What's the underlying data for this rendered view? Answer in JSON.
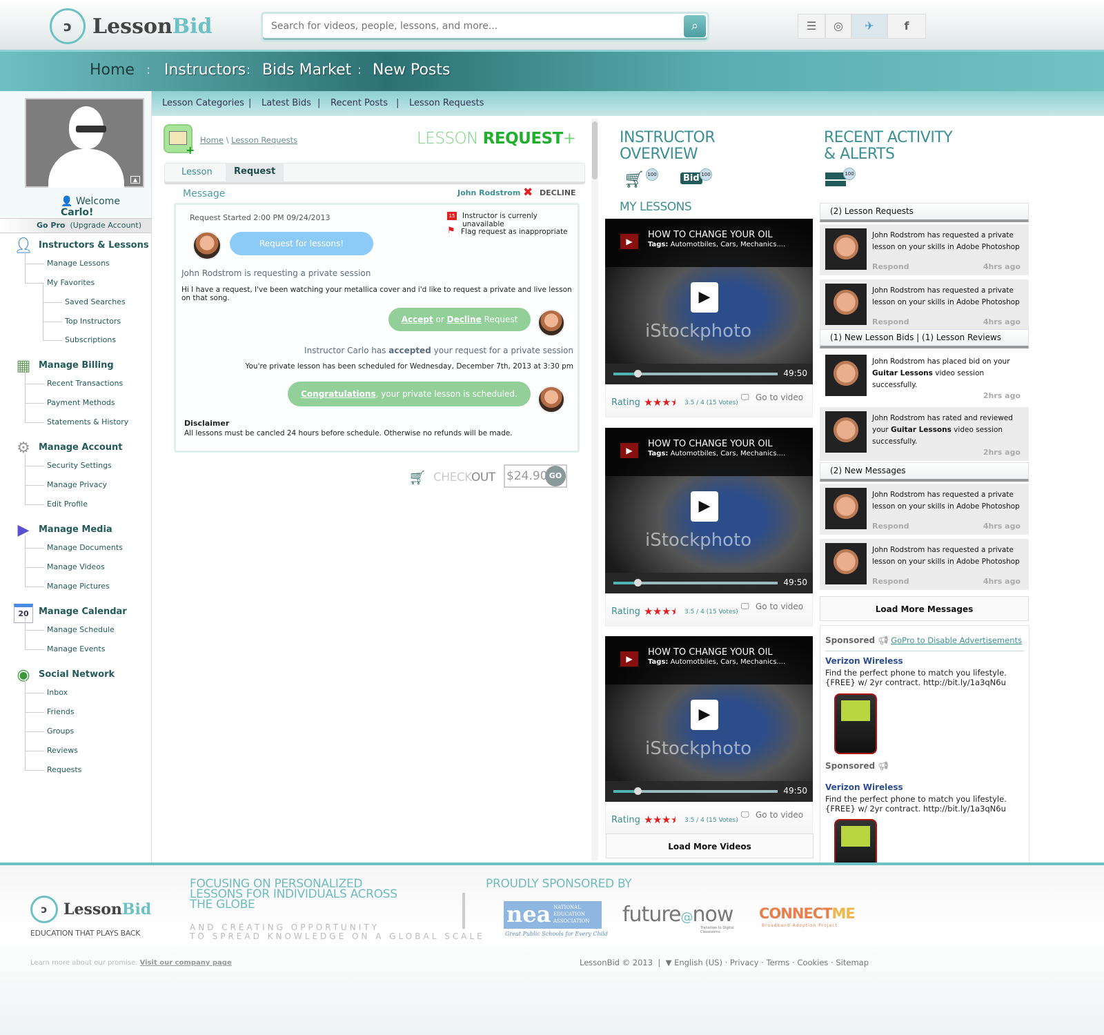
{
  "brand": {
    "name_a": "Lesson",
    "name_b": "Bid",
    "tagline": "EDUCATION THAT PLAYS BACK"
  },
  "search": {
    "placeholder": "Search for videos, people, lessons, and more...",
    "icon": "search-icon"
  },
  "social": [
    {
      "icon": "rss-icon",
      "glyph": "⦿"
    },
    {
      "icon": "dribbble-icon",
      "glyph": "◎"
    },
    {
      "icon": "twitter-icon",
      "glyph": "❧"
    },
    {
      "icon": "facebook-icon",
      "glyph": "f"
    }
  ],
  "nav": {
    "items": [
      "Home",
      "Instructors",
      "Bids Market",
      "New Posts"
    ],
    "active": "Home",
    "separator": ":"
  },
  "subnav": {
    "items": [
      "Lesson Categories",
      "Latest Bids",
      "Recent Posts",
      "Lesson Requests"
    ],
    "separator": "|"
  },
  "user": {
    "welcome": "Welcome",
    "name": "Carlo!",
    "go_pro": "Go Pro",
    "upgrade": "(Upgrade Account)"
  },
  "sidebar": [
    {
      "title": "Instructors & Lessons",
      "icon": "user-icon",
      "items": [
        {
          "label": "Manage Lessons",
          "level": 1
        },
        {
          "label": "My Favorites",
          "level": 1
        },
        {
          "label": "Saved Searches",
          "level": 2
        },
        {
          "label": "Top Instructors",
          "level": 2
        },
        {
          "label": "Subscriptions",
          "level": 2
        }
      ]
    },
    {
      "title": "Manage Billing",
      "icon": "calculator-icon",
      "items": [
        {
          "label": "Recent Transactions",
          "level": 1
        },
        {
          "label": "Payment Methods",
          "level": 1
        },
        {
          "label": "Statements & History",
          "level": 1
        }
      ]
    },
    {
      "title": "Manage Account",
      "icon": "gear-icon",
      "items": [
        {
          "label": "Security Settings",
          "level": 1
        },
        {
          "label": "Manage Privacy",
          "level": 1
        },
        {
          "label": "Edit Profile",
          "level": 1
        }
      ]
    },
    {
      "title": "Manage Media",
      "icon": "media-play-icon",
      "items": [
        {
          "label": "Manage Documents",
          "level": 1
        },
        {
          "label": "Manage Videos",
          "level": 1
        },
        {
          "label": "Manage Pictures",
          "level": 1
        }
      ]
    },
    {
      "title": "Manage Calendar",
      "icon": "calendar-icon",
      "calendar_day": "20",
      "items": [
        {
          "label": "Manage Schedule",
          "level": 1
        },
        {
          "label": "Manage Events",
          "level": 1
        }
      ]
    },
    {
      "title": "Social Network",
      "icon": "chat-icon",
      "items": [
        {
          "label": "Inbox",
          "level": 1
        },
        {
          "label": "Friends",
          "level": 1
        },
        {
          "label": "Groups",
          "level": 1
        },
        {
          "label": "Reviews",
          "level": 1
        },
        {
          "label": "Requests",
          "level": 1
        }
      ]
    }
  ],
  "request": {
    "breadcrumb": [
      "Home",
      "Lesson Requests"
    ],
    "title_light": "LESSON",
    "title_bold": "REQUEST",
    "title_plus": "+",
    "tabs": [
      "Lesson",
      "Request"
    ],
    "active_tab": "Request",
    "message_label": "Message",
    "sender": "John Rodstrom",
    "decline": "DECLINE",
    "started": "Request Started 2:00 PM 09/24/2013",
    "calendar_day": "15",
    "unavailable": "Instructor is currenly unavailable",
    "flag": "Flag request as inappropriate",
    "bubble1": "Request for lessons!",
    "requesting": "John Rodstrom is requesting a private session",
    "body": "Hi I have a request, I've been watching your metallica cover and i'd like to request a private and live lesson on that song.",
    "accept": "Accept",
    "or": "or",
    "decline_link": "Decline",
    "request_word": "Request",
    "accepted_pre": "Instructor Carlo has",
    "accepted_bold": "accepted",
    "accepted_post": "your request for a private session",
    "scheduled": "You're private lesson has been scheduled for Wednesday, December 7th, 2013 at 3:30 pm",
    "congrats": "Congratulations",
    "congrats_rest": ", your private lesson is scheduled.",
    "disclaimer_title": "Disclaimer",
    "disclaimer": "All lessons must be cancled 24 hours before schedule. Otherwise no refunds will be made.",
    "checkout_a": "CHECK",
    "checkout_b": "OUT",
    "price": "$24.90",
    "go": "GO"
  },
  "overview": {
    "title1": "INSTRUCTOR",
    "title2": "OVERVIEW",
    "badges": [
      {
        "icon": "cart-icon",
        "count": "100"
      },
      {
        "icon": "bid-icon",
        "label": "Bid",
        "count": "100"
      }
    ],
    "my_lessons": "MY LESSONS",
    "lessons": [
      {
        "title": "HOW TO CHANGE YOUR OIL",
        "tags_label": "Tags:",
        "tags": "Automotbiles, Cars, Mechanics....",
        "watermark": "iStockphoto",
        "duration": "49:50",
        "progress": 0.15,
        "rating_label": "Rating",
        "stars": 3.5,
        "rating": "3.5 / 4 (15 Votes)",
        "go": "Go to video"
      },
      {
        "title": "HOW TO CHANGE YOUR OIL",
        "tags_label": "Tags:",
        "tags": "Automotbiles, Cars, Mechanics....",
        "watermark": "iStockphoto",
        "duration": "49:50",
        "progress": 0.15,
        "rating_label": "Rating",
        "stars": 3.5,
        "rating": "3.5 / 4 (15 Votes)",
        "go": "Go to video"
      },
      {
        "title": "HOW TO CHANGE YOUR OIL",
        "tags_label": "Tags:",
        "tags": "Automotbiles, Cars, Mechanics....",
        "watermark": "iStockphoto",
        "duration": "49:50",
        "progress": 0.15,
        "rating_label": "Rating",
        "stars": 3.5,
        "rating": "3.5 / 4 (15 Votes)",
        "go": "Go to video"
      }
    ],
    "load_more": "Load More Videos"
  },
  "activity": {
    "title1": "RECENT ACTIVITY",
    "title2": "& ALERTS",
    "mail_count": "100",
    "requests_head": "(2) Lesson Requests",
    "requests": [
      {
        "text": "John Rodstrom has requested a private lesson on your skills in Adobe Photoshop",
        "action": "Respond",
        "time": "4hrs ago"
      },
      {
        "text": "John Rodstrom has requested a private lesson on your skills in Adobe Photoshop",
        "action": "Respond",
        "time": "4hrs ago"
      }
    ],
    "bids_head": "(1) New Lesson Bids  |  (1) Lesson Reviews",
    "bids": [
      {
        "text": "John Rodstrom has placed bid on your Guitar Lessons video session successfully.",
        "action": "",
        "time": "2hrs ago"
      },
      {
        "text": "John Rodstrom has rated and reviewed your Guitar Lessons video session successfully.",
        "action": "",
        "time": "2hrs ago"
      }
    ],
    "messages_head": "(2) New Messages",
    "messages": [
      {
        "text": "John Rodstrom has requested a private lesson on your skills in Adobe Photoshop",
        "action": "Respond",
        "time": "4hrs ago"
      },
      {
        "text": "John Rodstrom has requested a private lesson on your skills in Adobe Photoshop",
        "action": "Respond",
        "time": "4hrs ago"
      }
    ],
    "load_more": "Load More Messages"
  },
  "ads": {
    "sponsored": "Sponsored",
    "gopro": "GoPro to Disable Advertisements",
    "items": [
      {
        "advertiser": "Verizon Wireless",
        "line1": "Find the perfect phone to match you lifestyle.",
        "line2": "{FREE} w/ 2yr contract. http://bit.ly/1a3qN6u"
      },
      {
        "advertiser": "Verizon Wireless",
        "line1": "Find the perfect phone to match you lifestyle.",
        "line2": "{FREE} w/ 2yr contract. http://bit.ly/1a3qN6u"
      }
    ]
  },
  "footer": {
    "focus1": "FOCUSING ON PERSONALIZED",
    "focus2": "LESSONS FOR INDIVIDUALS ACROSS",
    "focus3": "THE GLOBE",
    "sub1": "AND CREATING OPPORTUNITY",
    "sub2": "TO SPREAD KNOWLEDGE ON A GLOBAL SCALE",
    "sponsored_by": "PROUDLY SPONSORED BY",
    "sponsors": {
      "nea": "nea",
      "nea_full": "NATIONAL EDUCATION ASSOCIATION",
      "nea_tag": "Great Public Schools for Every Child",
      "future": "future",
      "now": "now",
      "future_tag": "Transition to Digital Classrooms",
      "connect": "CONNECT",
      "me": "ME",
      "connect_tag": "Broadband Adoption Project"
    },
    "promise": "Learn more about our promise.",
    "company_link": "Visit our company page",
    "copyright": "LessonBid © 2013",
    "language": "English (US)",
    "links": [
      "Privacy",
      "Terms",
      "Cookies",
      "Sitemap"
    ]
  },
  "colors": {
    "teal": "#6fc0c3",
    "dark_teal": "#235a5a",
    "green": "#2db53d",
    "bubble_blue": "#8ccbf7",
    "bubble_green": "#92cf99",
    "star_red": "#e02020"
  }
}
